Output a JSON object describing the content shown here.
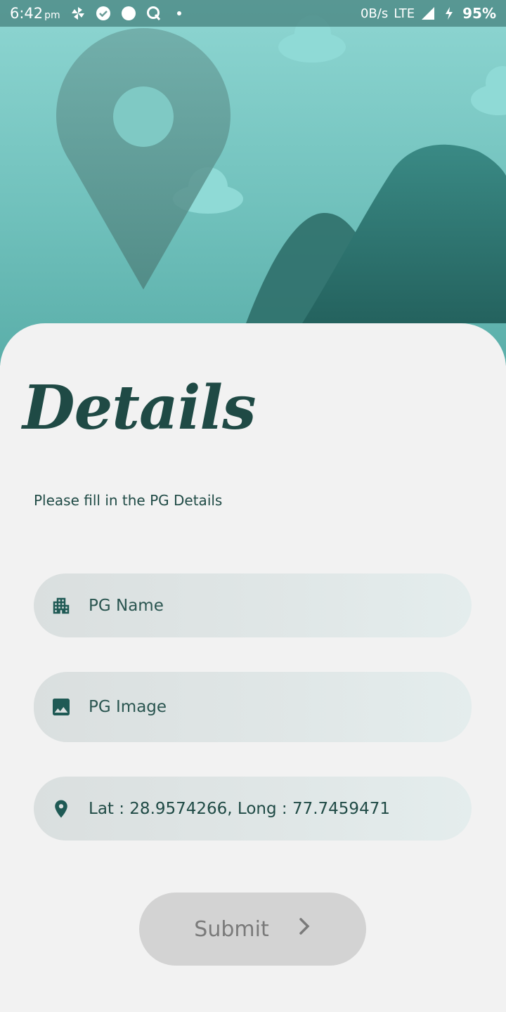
{
  "status_bar": {
    "time": "6:42",
    "ampm": "pm",
    "net_speed": "0B/s",
    "network": "LTE",
    "battery": "95%"
  },
  "page": {
    "title": "Details",
    "subtitle": "Please fill in the PG Details"
  },
  "form": {
    "name_placeholder": "PG Name",
    "image_placeholder": "PG Image",
    "location_text": "Lat : 28.9574266, Long : 77.7459471",
    "submit_label": "Submit"
  },
  "colors": {
    "accent": "#1f4a45",
    "header_teal": "#6fc0bb",
    "mountain": "#2e6e69",
    "button_bg": "#d3d3d3"
  },
  "icons": {
    "name_field": "apartment-icon",
    "image_field": "image-icon",
    "location_field": "location-pin-icon",
    "submit": "chevron-right-icon"
  }
}
